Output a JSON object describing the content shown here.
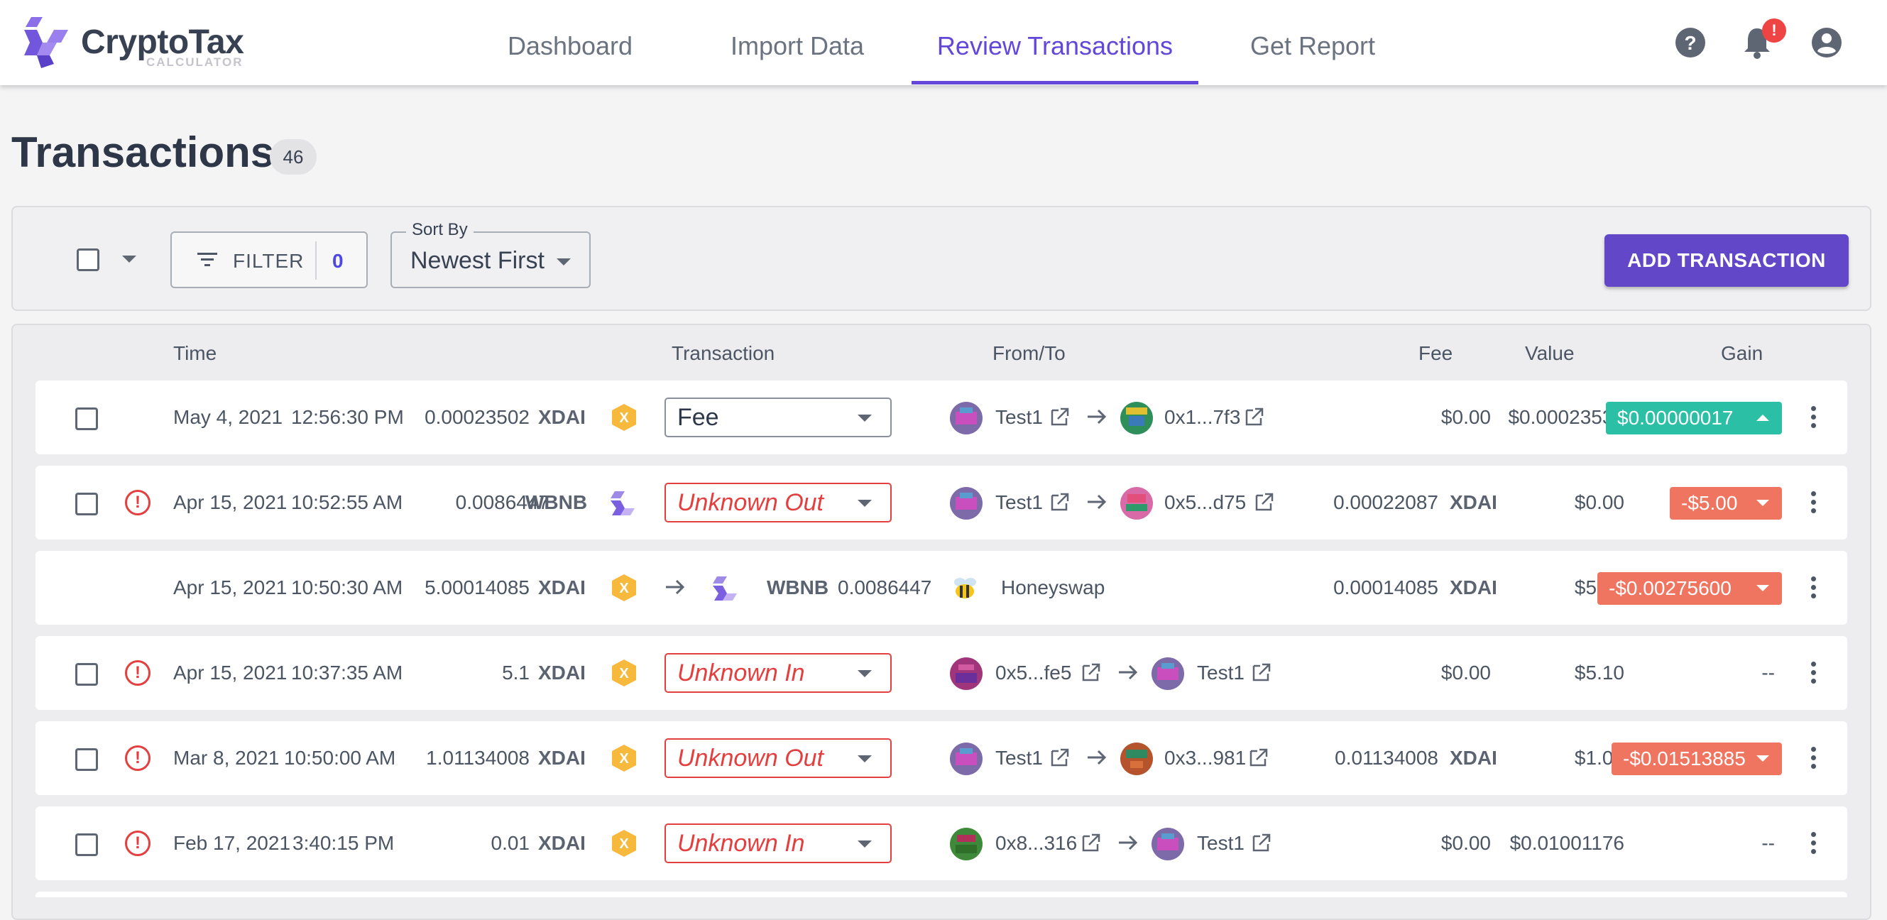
{
  "app": {
    "logo_text": "CryptoTax",
    "logo_sub": "CALCULATOR",
    "nav": [
      "Dashboard",
      "Import Data",
      "Review Transactions",
      "Get Report"
    ],
    "active_nav": "Review Transactions",
    "notification_badge": "!"
  },
  "page": {
    "title": "Transactions",
    "count": "46"
  },
  "toolbar": {
    "filter_label": "FILTER",
    "filter_count": "0",
    "sort_label": "Sort By",
    "sort_value": "Newest First",
    "add_button": "ADD TRANSACTION"
  },
  "columns": {
    "time": "Time",
    "transaction": "Transaction",
    "fromto": "From/To",
    "fee": "Fee",
    "value": "Value",
    "gain": "Gain"
  },
  "rows": [
    {
      "has_checkbox": true,
      "warning": false,
      "date": "May 4, 2021",
      "time": "12:56:30 PM",
      "amount": "0.00023502",
      "currency": "XDAI",
      "coin": "xdai-icon",
      "type": "Fee",
      "type_unknown": false,
      "from": "Test1",
      "to": "0x1...7f3",
      "fee": "$0.00",
      "fee_currency": "",
      "value": "$0.00023530",
      "gain": "$0.00000017",
      "gain_direction": "up"
    },
    {
      "has_checkbox": true,
      "warning": true,
      "date": "Apr 15, 2021",
      "time": "10:52:55 AM",
      "amount": "0.0086447",
      "currency": "WBNB",
      "coin": "wbnb-icon",
      "type": "Unknown Out",
      "type_unknown": true,
      "from": "Test1",
      "to": "0x5...d75",
      "fee": "0.00022087",
      "fee_currency": "XDAI",
      "value": "$0.00",
      "gain": "-$5.00",
      "gain_direction": "down"
    },
    {
      "has_checkbox": false,
      "warning": false,
      "date": "Apr 15, 2021",
      "time": "10:50:30 AM",
      "amount": "5.00014085",
      "currency": "XDAI",
      "coin": "xdai-icon",
      "swap_to_currency": "WBNB",
      "swap_to_amount": "0.0086447",
      "platform": "Honeyswap",
      "fee": "0.00014085",
      "fee_currency": "XDAI",
      "value": "$5.00",
      "gain": "-$0.00275600",
      "gain_direction": "down"
    },
    {
      "has_checkbox": true,
      "warning": true,
      "date": "Apr 15, 2021",
      "time": "10:37:35 AM",
      "amount": "5.1",
      "currency": "XDAI",
      "coin": "xdai-icon",
      "type": "Unknown In",
      "type_unknown": true,
      "from": "0x5...fe5",
      "to": "Test1",
      "fee": "$0.00",
      "fee_currency": "",
      "value": "$5.10",
      "gain": "--",
      "gain_direction": "none"
    },
    {
      "has_checkbox": true,
      "warning": true,
      "date": "Mar 8, 2021",
      "time": "10:50:00 AM",
      "amount": "1.01134008",
      "currency": "XDAI",
      "coin": "xdai-icon",
      "type": "Unknown Out",
      "type_unknown": true,
      "from": "Test1",
      "to": "0x3...981",
      "fee": "0.01134008",
      "fee_currency": "XDAI",
      "value": "$1.00",
      "gain": "-$0.01513885",
      "gain_direction": "down"
    },
    {
      "has_checkbox": true,
      "warning": true,
      "date": "Feb 17, 2021",
      "time": "3:40:15 PM",
      "amount": "0.01",
      "currency": "XDAI",
      "coin": "xdai-icon",
      "type": "Unknown In",
      "type_unknown": true,
      "from": "0x8...316",
      "to": "Test1",
      "fee": "$0.00",
      "fee_currency": "",
      "value": "$0.01001176",
      "gain": "--",
      "gain_direction": "none"
    }
  ],
  "colors": {
    "brand": "#6347d9",
    "gain_positive": "#2bbfa6",
    "gain_negative": "#f07560",
    "warning": "#e53e3e"
  }
}
